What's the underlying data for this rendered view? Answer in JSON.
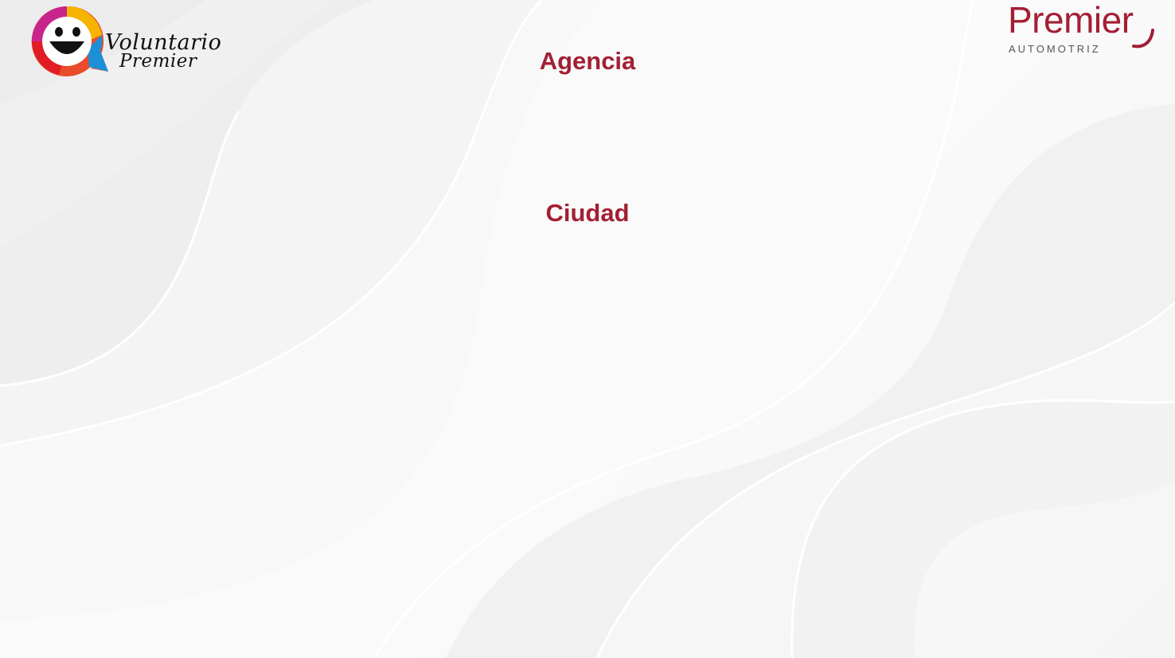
{
  "logos": {
    "left": {
      "line1": "Voluntario",
      "line2": "Premier",
      "icon": "smiley-face-icon"
    },
    "right": {
      "brand": "Premier",
      "subtitle": "AUTOMOTRIZ"
    }
  },
  "content": {
    "heading_1": "Agencia",
    "heading_2": "Ciudad"
  },
  "colors": {
    "brand_red": "#a31f34",
    "background": "#f7f7f7"
  }
}
